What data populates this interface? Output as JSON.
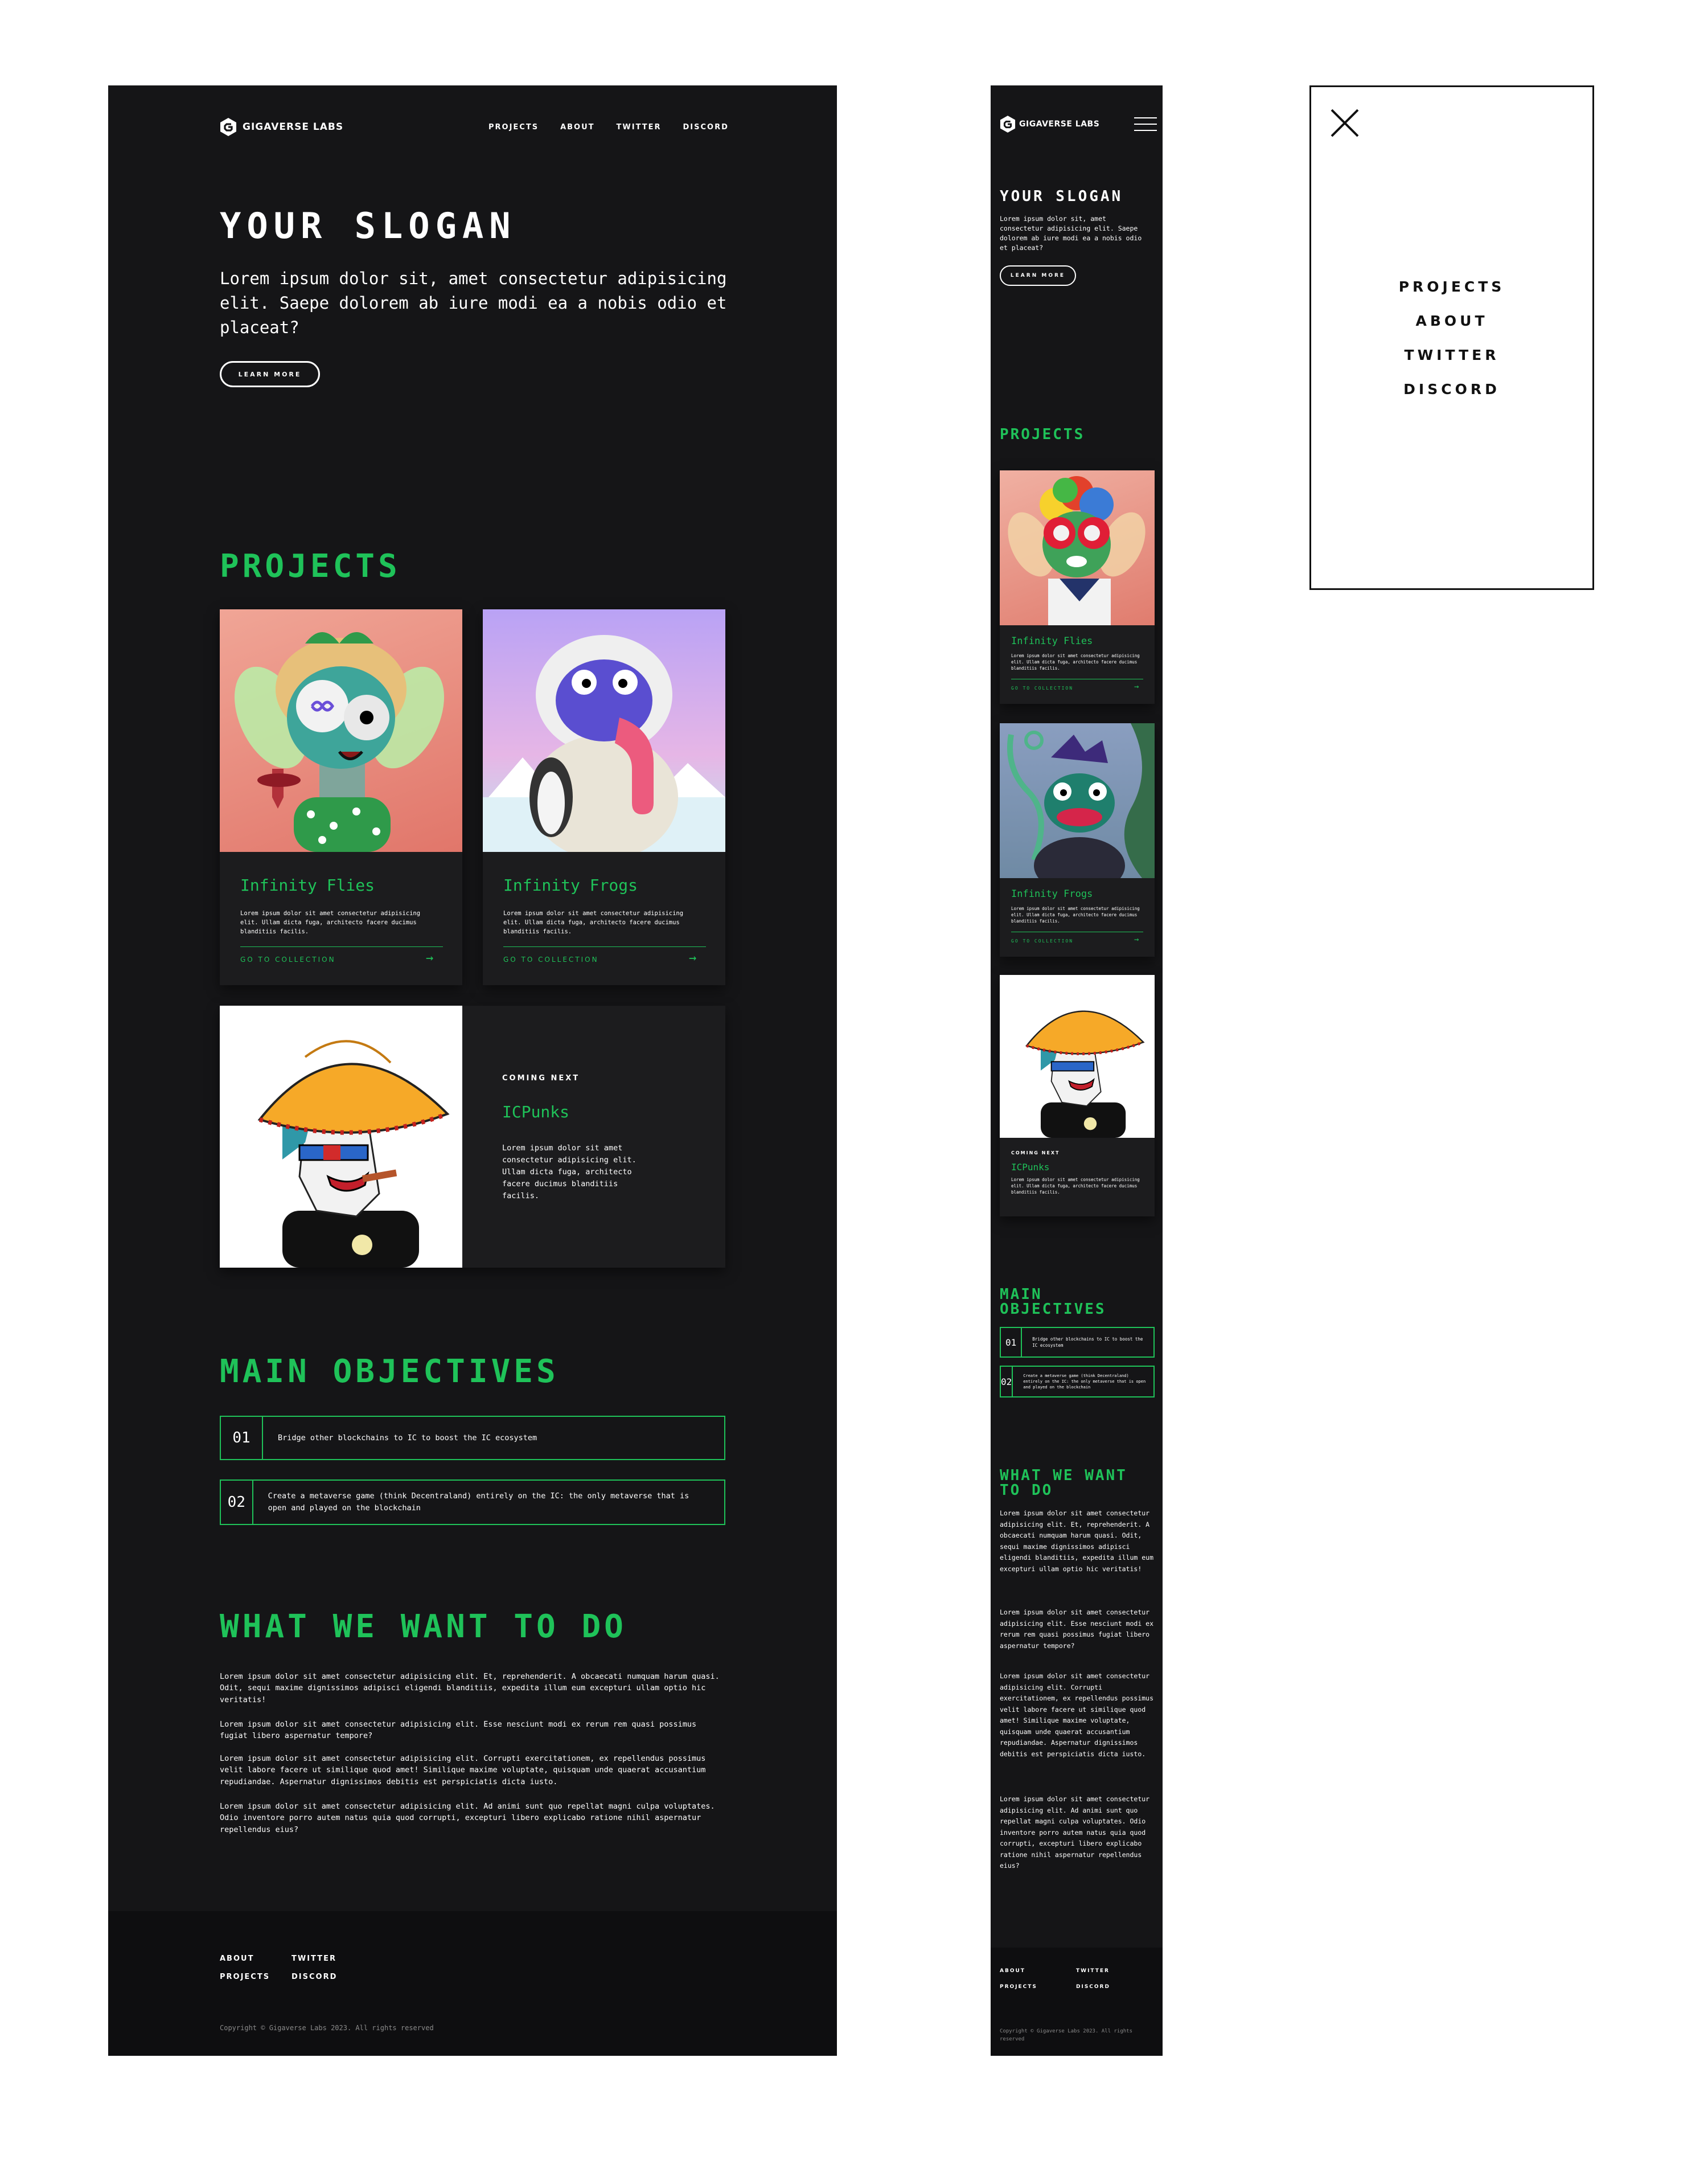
{
  "brand": {
    "name": "GIGAVERSE LABS"
  },
  "nav": {
    "projects": "PROJECTS",
    "about": "ABOUT",
    "twitter": "TWITTER",
    "discord": "DISCORD"
  },
  "hero": {
    "slogan": "YOUR SLOGAN",
    "text": "Lorem ipsum dolor sit, amet consectetur adipisicing elit. Saepe dolorem ab iure modi ea a nobis odio et placeat?",
    "button": "LEARN MORE"
  },
  "projects": {
    "title": "PROJECTS",
    "cards": [
      {
        "title": "Infinity Flies",
        "text": "Lorem ipsum dolor sit amet consectetur adipisicing elit. Ullam dicta fuga, architecto facere ducimus blanditiis facilis.",
        "link": "GO TO COLLECTION"
      },
      {
        "title": "Infinity Frogs",
        "text": "Lorem ipsum dolor sit amet consectetur adipisicing elit. Ullam dicta fuga, architecto facere ducimus blanditiis facilis.",
        "link": "GO TO COLLECTION"
      },
      {
        "label": "COMING NEXT",
        "title": "ICPunks",
        "text": "Lorem ipsum dolor sit amet consectetur adipisicing elit. Ullam dicta fuga, architecto facere ducimus blanditiis facilis."
      }
    ]
  },
  "objectives": {
    "title": "MAIN OBJECTIVES",
    "items": [
      {
        "num": "01",
        "text": "Bridge other blockchains to IC to boost the IC ecosystem"
      },
      {
        "num": "02",
        "text": "Create a metaverse game (think Decentraland) entirely on the IC: the only metaverse that is open and played on the blockchain"
      }
    ]
  },
  "todo": {
    "title": "WHAT WE WANT TO DO",
    "paragraphs": [
      "Lorem ipsum dolor sit amet consectetur adipisicing elit. Et, reprehenderit. A obcaecati numquam harum quasi. Odit, sequi maxime dignissimos adipisci eligendi blanditiis, expedita illum eum excepturi ullam optio hic veritatis!",
      "Lorem ipsum dolor sit amet consectetur adipisicing elit. Esse nesciunt modi ex rerum rem quasi possimus fugiat libero aspernatur tempore?",
      "Lorem ipsum dolor sit amet consectetur adipisicing elit. Corrupti exercitationem, ex repellendus possimus velit labore facere ut similique quod amet! Similique maxime voluptate, quisquam unde quaerat accusantium repudiandae. Aspernatur dignissimos debitis est perspiciatis dicta iusto.",
      "Lorem ipsum dolor sit amet consectetur adipisicing elit. Ad animi sunt quo repellat magni culpa voluptates. Odio inventore porro autem natus quia quod corrupti, excepturi libero explicabo ratione nihil aspernatur repellendus eius?"
    ]
  },
  "footer": {
    "about": "ABOUT",
    "projects": "PROJECTS",
    "twitter": "TWITTER",
    "discord": "DISCORD",
    "copyright_desktop": "Copyright © Gigaverse Labs 2023. All rights reserved",
    "copyright_mobile": "Copyright © Gigaverse Labs 2023. All rights reserved"
  },
  "menu": {
    "items": [
      "PROJECTS",
      "ABOUT",
      "TWITTER",
      "DISCORD"
    ]
  },
  "colors": {
    "accent": "#1fc259",
    "background": "#151517",
    "card": "#1c1c1e"
  }
}
